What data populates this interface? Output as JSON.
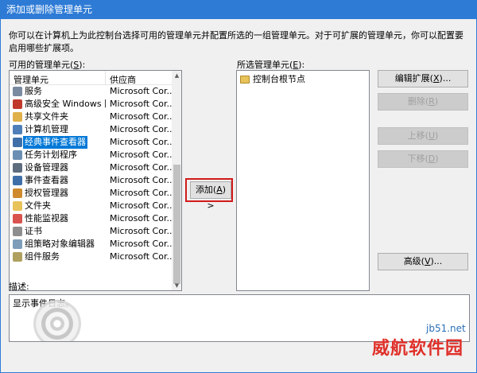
{
  "window": {
    "title": "添加或删除管理单元"
  },
  "intro": "你可以在计算机上为此控制台选择可用的管理单元并配置所选的一组管理单元。对于可扩展的管理单元，你可以配置要启用哪些扩展项。",
  "available": {
    "label": "可用的管理单元(",
    "accel": "S",
    "label_end": "):",
    "col_name": "管理单元",
    "col_vendor": "供应商",
    "items": [
      {
        "name": "服务",
        "vendor": "Microsoft Cor...",
        "color": "#7a8aa0"
      },
      {
        "name": "高级安全 Windows 防...",
        "vendor": "Microsoft Cor...",
        "color": "#c0392b"
      },
      {
        "name": "共享文件夹",
        "vendor": "Microsoft Cor...",
        "color": "#e0b04a"
      },
      {
        "name": "计算机管理",
        "vendor": "Microsoft Cor...",
        "color": "#4f7fb8"
      },
      {
        "name": "经典事件查看器",
        "vendor": "Microsoft Cor...",
        "color": "#3f6fa8"
      },
      {
        "name": "任务计划程序",
        "vendor": "Microsoft Cor...",
        "color": "#6b8fb3"
      },
      {
        "name": "设备管理器",
        "vendor": "Microsoft Cor...",
        "color": "#5d6d7e"
      },
      {
        "name": "事件查看器",
        "vendor": "Microsoft Cor...",
        "color": "#3f6fa8"
      },
      {
        "name": "授权管理器",
        "vendor": "Microsoft Cor...",
        "color": "#d08a2e"
      },
      {
        "name": "文件夹",
        "vendor": "Microsoft Cor...",
        "color": "#e8c35a"
      },
      {
        "name": "性能监视器",
        "vendor": "Microsoft Cor...",
        "color": "#d9534f"
      },
      {
        "name": "证书",
        "vendor": "Microsoft Cor...",
        "color": "#8e8e8e"
      },
      {
        "name": "组策略对象编辑器",
        "vendor": "Microsoft Cor...",
        "color": "#7d9db8"
      },
      {
        "name": "组件服务",
        "vendor": "Microsoft Cor...",
        "color": "#b0a060"
      }
    ],
    "selected_index": 4
  },
  "add_button": {
    "label": "添加(",
    "accel": "A",
    "label_end": ") >"
  },
  "selected": {
    "label": "所选管理单元(",
    "accel": "E",
    "label_end": "):",
    "root": "控制台根节点"
  },
  "buttons": {
    "edit_ext": {
      "label": "编辑扩展(",
      "accel": "X",
      "label_end": ")..."
    },
    "remove": {
      "label": "删除(",
      "accel": "R",
      "label_end": ")"
    },
    "move_up": {
      "label": "上移(",
      "accel": "U",
      "label_end": ")"
    },
    "move_down": {
      "label": "下移(",
      "accel": "D",
      "label_end": ")"
    },
    "advanced": {
      "label": "高级(",
      "accel": "V",
      "label_end": ")..."
    }
  },
  "description": {
    "label": "描述:",
    "text": "显示事件日志。"
  },
  "watermark": {
    "brand": "威航软件园",
    "site": "jb51.net"
  }
}
